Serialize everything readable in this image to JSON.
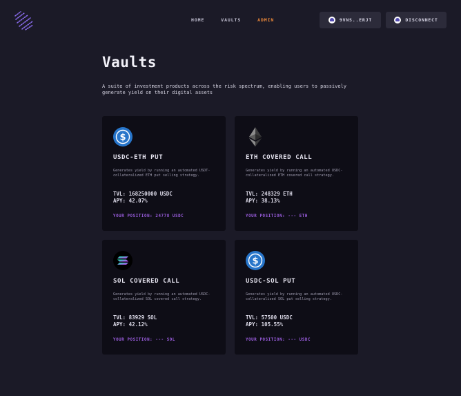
{
  "header": {
    "nav": [
      {
        "label": "HOME",
        "active": false
      },
      {
        "label": "VAULTS",
        "active": false
      },
      {
        "label": "ADMIN",
        "active": true
      }
    ],
    "wallet_label": "9VNS..ERJT",
    "disconnect_label": "DISCONNECT",
    "active_color": "#f08a3a"
  },
  "main": {
    "title": "Vaults",
    "subtitle": "A suite of investment products across the risk spectrum, enabling users to passively generate yield on their digital assets"
  },
  "vaults": [
    {
      "icon": "usdc-icon",
      "name": "USDC-ETH PUT",
      "description": "Generates yield by running an automated USDT-collateralized ETH put selling strategy.",
      "tvl": "TVL: 168250000 USDC",
      "apy": "APY: 42.07%",
      "position": "YOUR POSITION: 24778 USDC"
    },
    {
      "icon": "eth-icon",
      "name": "ETH COVERED CALL",
      "description": "Generates yield by running an automated USDC-collateralized ETH covered call strategy.",
      "tvl": "TVL: 248329 ETH",
      "apy": "APY: 38.13%",
      "position": "YOUR POSITION: --- ETH"
    },
    {
      "icon": "sol-icon",
      "name": "SOL COVERED CALL",
      "description": "Generates yield by running an automated USDC-collateralized SOL covered call strategy.",
      "tvl": "TVL: 83929 SOL",
      "apy": "APY: 42.12%",
      "position": "YOUR POSITION: --- SOL"
    },
    {
      "icon": "usdc-icon",
      "name": "USDC-SOL PUT",
      "description": "Generates yield by running an automated USDC-collateralized SOL put selling strategy.",
      "tvl": "TVL: 57500 USDC",
      "apy": "APY: 105.55%",
      "position": "YOUR POSITION: --- USDC"
    }
  ],
  "colors": {
    "background": "#1b1a27",
    "card": "#0e0d16",
    "position_text": "#9c5ee0",
    "usdc_blue": "#2775ca"
  }
}
